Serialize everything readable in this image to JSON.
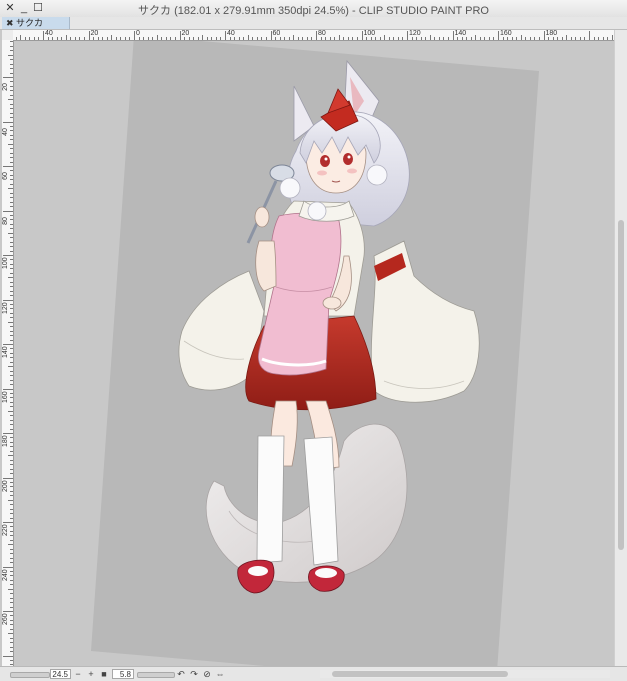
{
  "window": {
    "title": "サクカ (182.01 x 279.91mm 350dpi 24.5%)  - CLIP STUDIO PAINT PRO",
    "minimize_glyph": "_",
    "maximize_glyph": "☐",
    "close_glyph": "✕"
  },
  "tab": {
    "label": "サクカ",
    "close_glyph": "✖"
  },
  "ruler": {
    "horizontal": [
      "40",
      "20",
      "0",
      "20",
      "40",
      "60",
      "80",
      "100",
      "120",
      "140",
      "160",
      "180"
    ],
    "vertical": [
      "20",
      "40",
      "60",
      "80",
      "100",
      "120",
      "140",
      "160",
      "180",
      "200",
      "220",
      "240",
      "260"
    ]
  },
  "status": {
    "zoom_value": "24.5",
    "zoom_out_glyph": "−",
    "zoom_in_glyph": "+",
    "fit_glyph": "■",
    "rotation_value": "5.8",
    "rotate_left_glyph": "↶",
    "rotate_right_glyph": "↷",
    "reset_glyph": "⊘",
    "flip_glyph": "⇔"
  },
  "colors": {
    "canvas_bg": "#c8c8c8",
    "paper": "#b8b8b8",
    "kimono": "#f4f2ea",
    "apron": "#f1bdd1",
    "skirt": "#b5281e",
    "hair": "#eeeef4",
    "hat": "#c32b20",
    "sandals": "#c2273a"
  }
}
